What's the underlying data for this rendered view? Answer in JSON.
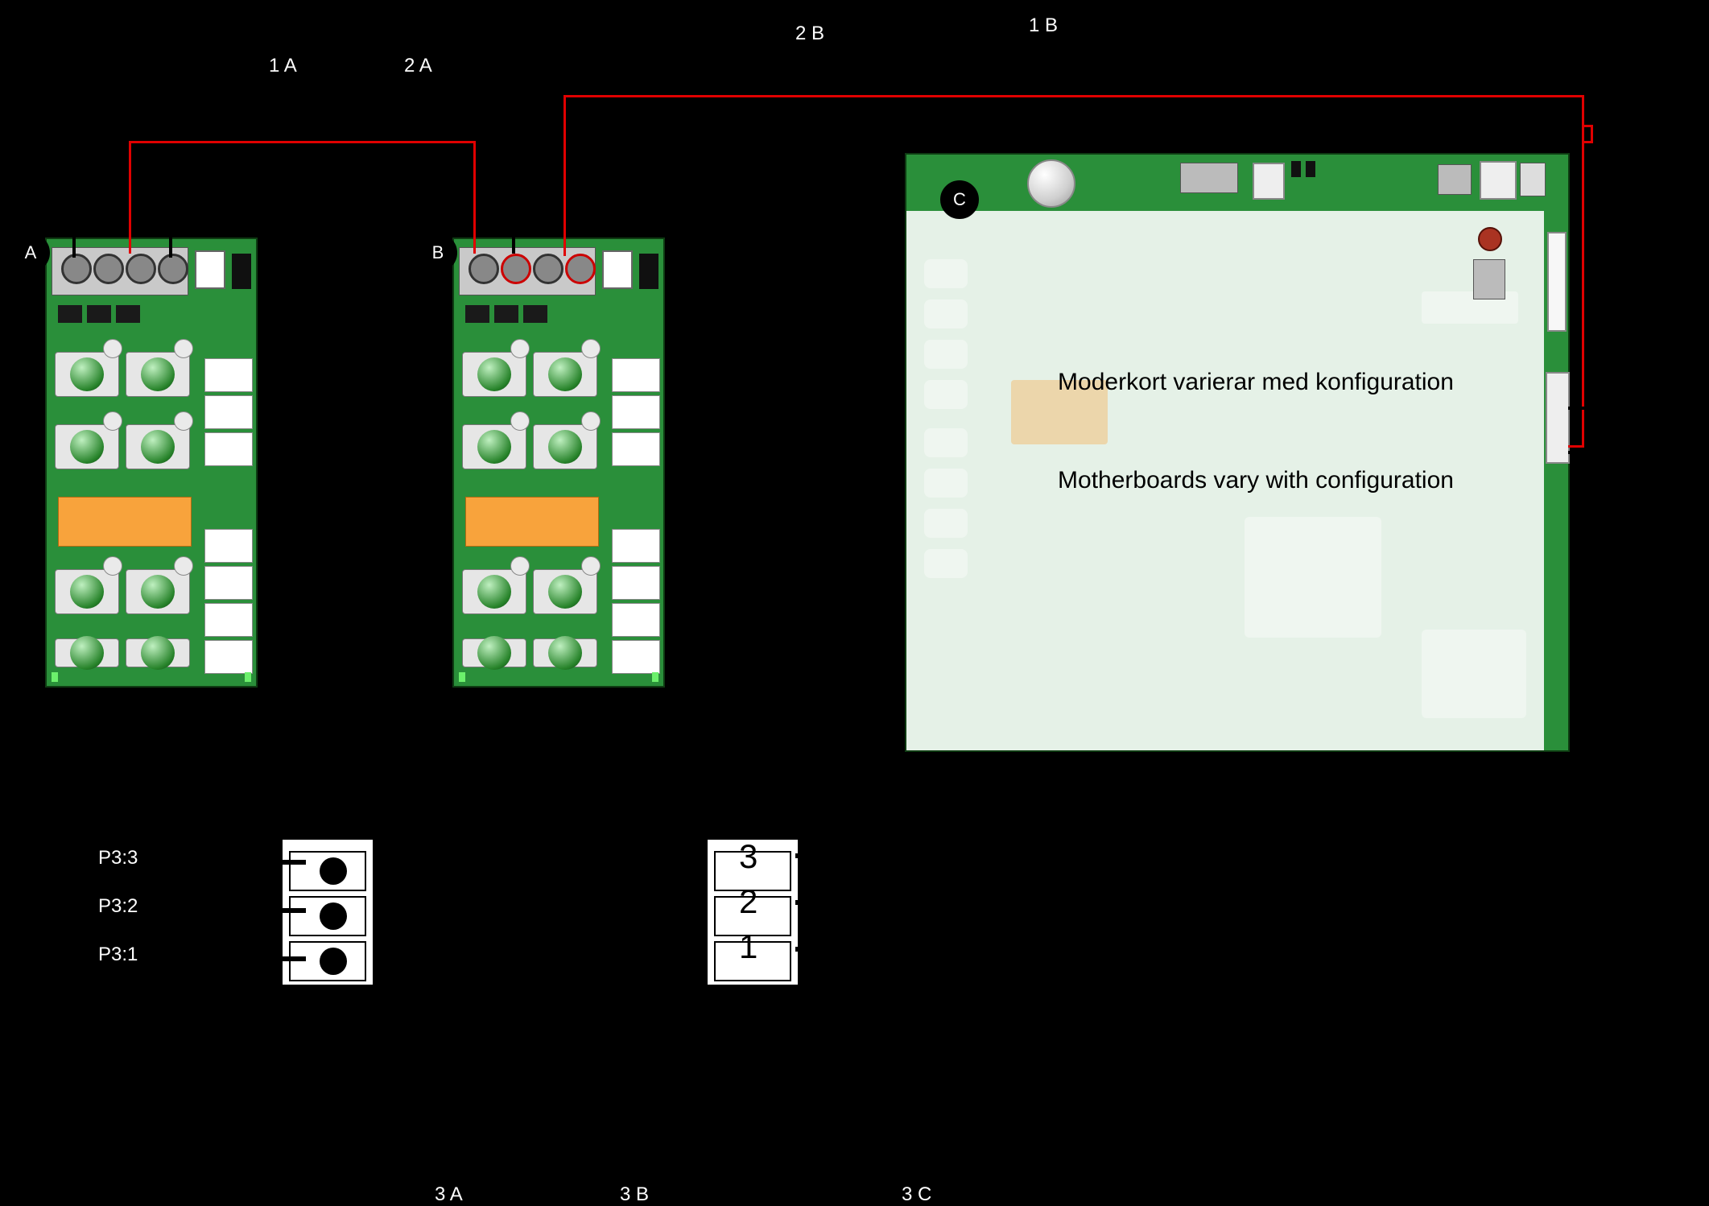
{
  "labels": {
    "oneA": "1 A",
    "twoA": "2 A",
    "twoB": "2 B",
    "oneB": "1 B",
    "threeA": "3 A",
    "threeB": "3 B",
    "threeC": "3 C",
    "badgeA": "A",
    "badgeB": "B",
    "badgeC": "C",
    "p3_3": "P3:3",
    "p3_2": "P3:2",
    "p3_1": "P3:1",
    "num3": "3",
    "num2": "2",
    "num1": "1"
  },
  "notes": {
    "sv": "Moderkort varierar med konfiguration",
    "en": "Motherboards vary with configuration"
  },
  "boards": {
    "A": {
      "id": "A",
      "terminals": 4
    },
    "B": {
      "id": "B",
      "terminals": 4
    },
    "C": {
      "id": "C",
      "type": "motherboard"
    }
  },
  "colors": {
    "pcb": "#2a8f3a",
    "wire_red": "#e00000",
    "wire_black": "#000000",
    "ic_orange": "#f8a33c"
  },
  "connectors": {
    "left": {
      "rows": [
        "P3:3",
        "P3:2",
        "P3:1"
      ]
    },
    "right": {
      "rows": [
        "3",
        "2",
        "1"
      ]
    }
  },
  "wiring": [
    "A.P1 black goes up to label 1A",
    "A.P4 black goes up to label 2A",
    "A red bus to B.P1/P3 then across to motherboard C right connector",
    "C right connector 2-pin red + black down-loop"
  ]
}
